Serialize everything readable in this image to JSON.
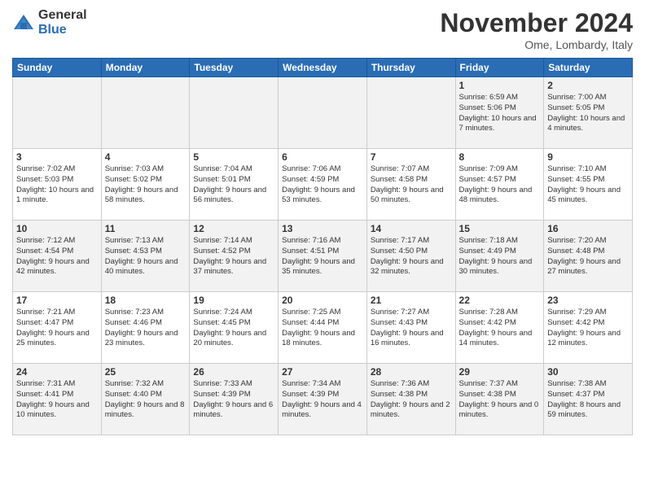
{
  "logo": {
    "general": "General",
    "blue": "Blue"
  },
  "header": {
    "month": "November 2024",
    "location": "Ome, Lombardy, Italy"
  },
  "weekdays": [
    "Sunday",
    "Monday",
    "Tuesday",
    "Wednesday",
    "Thursday",
    "Friday",
    "Saturday"
  ],
  "weeks": [
    [
      {
        "day": "",
        "info": ""
      },
      {
        "day": "",
        "info": ""
      },
      {
        "day": "",
        "info": ""
      },
      {
        "day": "",
        "info": ""
      },
      {
        "day": "",
        "info": ""
      },
      {
        "day": "1",
        "info": "Sunrise: 6:59 AM\nSunset: 5:06 PM\nDaylight: 10 hours\nand 7 minutes."
      },
      {
        "day": "2",
        "info": "Sunrise: 7:00 AM\nSunset: 5:05 PM\nDaylight: 10 hours\nand 4 minutes."
      }
    ],
    [
      {
        "day": "3",
        "info": "Sunrise: 7:02 AM\nSunset: 5:03 PM\nDaylight: 10 hours\nand 1 minute."
      },
      {
        "day": "4",
        "info": "Sunrise: 7:03 AM\nSunset: 5:02 PM\nDaylight: 9 hours\nand 58 minutes."
      },
      {
        "day": "5",
        "info": "Sunrise: 7:04 AM\nSunset: 5:01 PM\nDaylight: 9 hours\nand 56 minutes."
      },
      {
        "day": "6",
        "info": "Sunrise: 7:06 AM\nSunset: 4:59 PM\nDaylight: 9 hours\nand 53 minutes."
      },
      {
        "day": "7",
        "info": "Sunrise: 7:07 AM\nSunset: 4:58 PM\nDaylight: 9 hours\nand 50 minutes."
      },
      {
        "day": "8",
        "info": "Sunrise: 7:09 AM\nSunset: 4:57 PM\nDaylight: 9 hours\nand 48 minutes."
      },
      {
        "day": "9",
        "info": "Sunrise: 7:10 AM\nSunset: 4:55 PM\nDaylight: 9 hours\nand 45 minutes."
      }
    ],
    [
      {
        "day": "10",
        "info": "Sunrise: 7:12 AM\nSunset: 4:54 PM\nDaylight: 9 hours\nand 42 minutes."
      },
      {
        "day": "11",
        "info": "Sunrise: 7:13 AM\nSunset: 4:53 PM\nDaylight: 9 hours\nand 40 minutes."
      },
      {
        "day": "12",
        "info": "Sunrise: 7:14 AM\nSunset: 4:52 PM\nDaylight: 9 hours\nand 37 minutes."
      },
      {
        "day": "13",
        "info": "Sunrise: 7:16 AM\nSunset: 4:51 PM\nDaylight: 9 hours\nand 35 minutes."
      },
      {
        "day": "14",
        "info": "Sunrise: 7:17 AM\nSunset: 4:50 PM\nDaylight: 9 hours\nand 32 minutes."
      },
      {
        "day": "15",
        "info": "Sunrise: 7:18 AM\nSunset: 4:49 PM\nDaylight: 9 hours\nand 30 minutes."
      },
      {
        "day": "16",
        "info": "Sunrise: 7:20 AM\nSunset: 4:48 PM\nDaylight: 9 hours\nand 27 minutes."
      }
    ],
    [
      {
        "day": "17",
        "info": "Sunrise: 7:21 AM\nSunset: 4:47 PM\nDaylight: 9 hours\nand 25 minutes."
      },
      {
        "day": "18",
        "info": "Sunrise: 7:23 AM\nSunset: 4:46 PM\nDaylight: 9 hours\nand 23 minutes."
      },
      {
        "day": "19",
        "info": "Sunrise: 7:24 AM\nSunset: 4:45 PM\nDaylight: 9 hours\nand 20 minutes."
      },
      {
        "day": "20",
        "info": "Sunrise: 7:25 AM\nSunset: 4:44 PM\nDaylight: 9 hours\nand 18 minutes."
      },
      {
        "day": "21",
        "info": "Sunrise: 7:27 AM\nSunset: 4:43 PM\nDaylight: 9 hours\nand 16 minutes."
      },
      {
        "day": "22",
        "info": "Sunrise: 7:28 AM\nSunset: 4:42 PM\nDaylight: 9 hours\nand 14 minutes."
      },
      {
        "day": "23",
        "info": "Sunrise: 7:29 AM\nSunset: 4:42 PM\nDaylight: 9 hours\nand 12 minutes."
      }
    ],
    [
      {
        "day": "24",
        "info": "Sunrise: 7:31 AM\nSunset: 4:41 PM\nDaylight: 9 hours\nand 10 minutes."
      },
      {
        "day": "25",
        "info": "Sunrise: 7:32 AM\nSunset: 4:40 PM\nDaylight: 9 hours\nand 8 minutes."
      },
      {
        "day": "26",
        "info": "Sunrise: 7:33 AM\nSunset: 4:39 PM\nDaylight: 9 hours\nand 6 minutes."
      },
      {
        "day": "27",
        "info": "Sunrise: 7:34 AM\nSunset: 4:39 PM\nDaylight: 9 hours\nand 4 minutes."
      },
      {
        "day": "28",
        "info": "Sunrise: 7:36 AM\nSunset: 4:38 PM\nDaylight: 9 hours\nand 2 minutes."
      },
      {
        "day": "29",
        "info": "Sunrise: 7:37 AM\nSunset: 4:38 PM\nDaylight: 9 hours\nand 0 minutes."
      },
      {
        "day": "30",
        "info": "Sunrise: 7:38 AM\nSunset: 4:37 PM\nDaylight: 8 hours\nand 59 minutes."
      }
    ]
  ]
}
